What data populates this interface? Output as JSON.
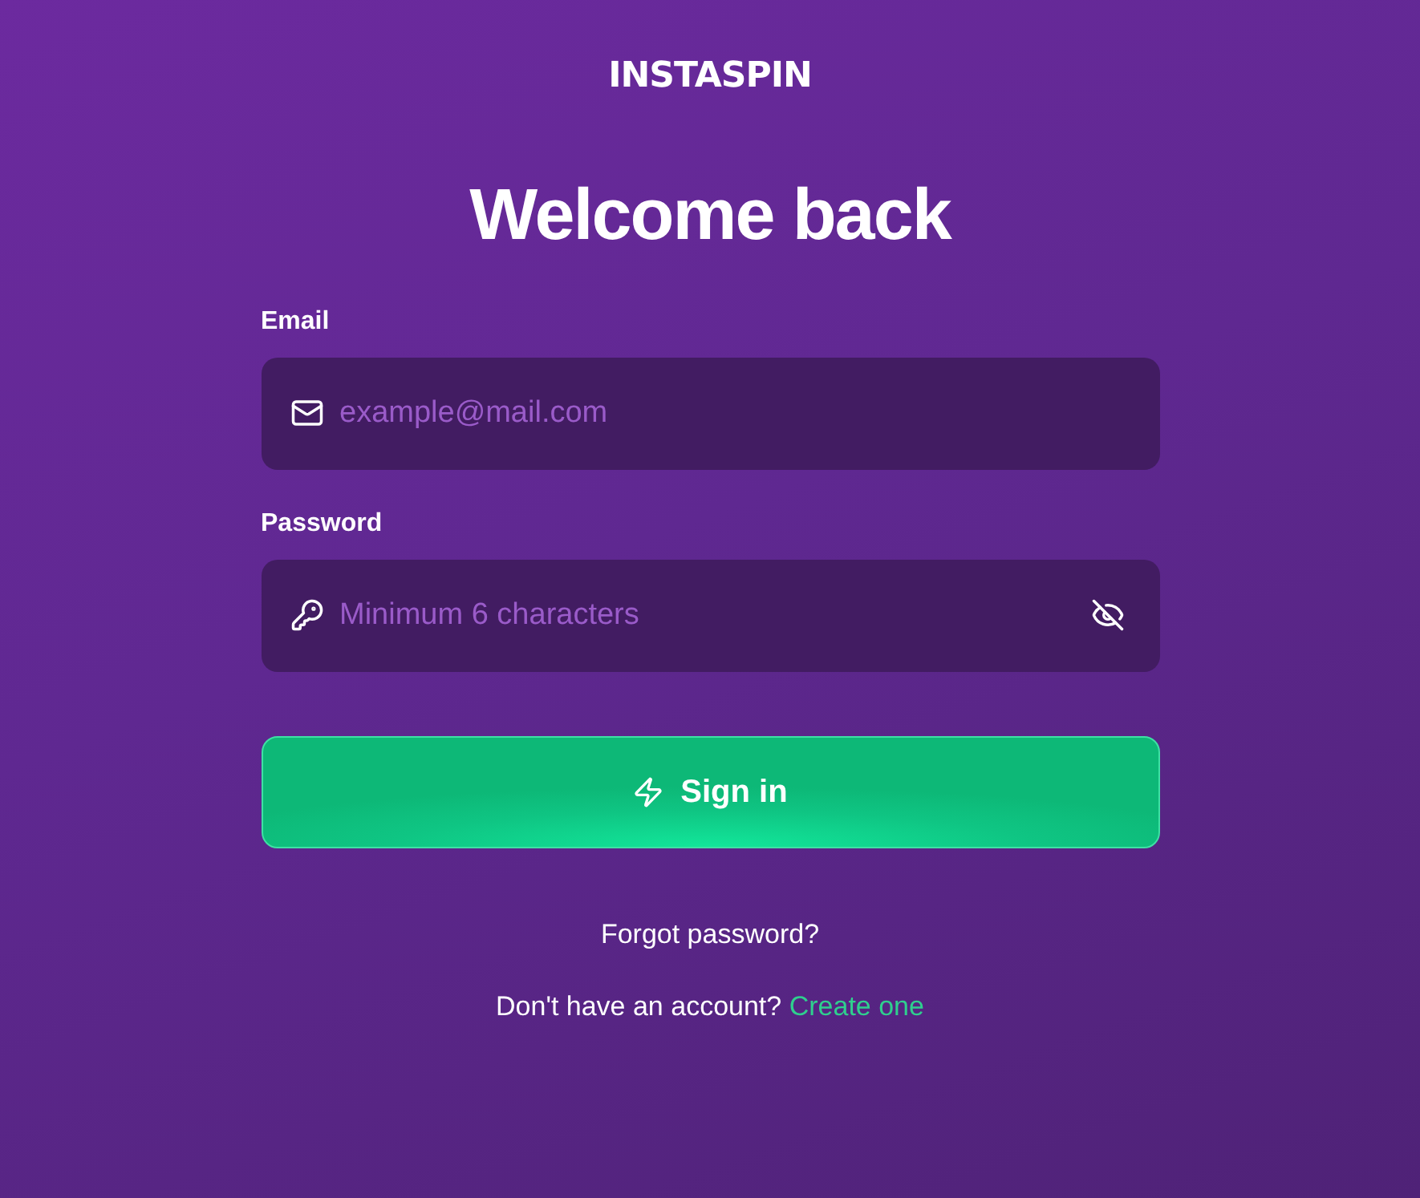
{
  "logo": {
    "text": "INSTASPIN"
  },
  "title": "Welcome back",
  "fields": [
    {
      "kind": "email",
      "label": "Email",
      "placeholder": "example@mail.com"
    },
    {
      "kind": "password",
      "label": "Password",
      "placeholder": "Minimum 6 characters",
      "revealed": false
    }
  ],
  "submit": {
    "label": "Sign in"
  },
  "forgot_link": "Forgot password?",
  "signup": {
    "prompt": "Don't have an account?",
    "link": "Create one"
  }
}
